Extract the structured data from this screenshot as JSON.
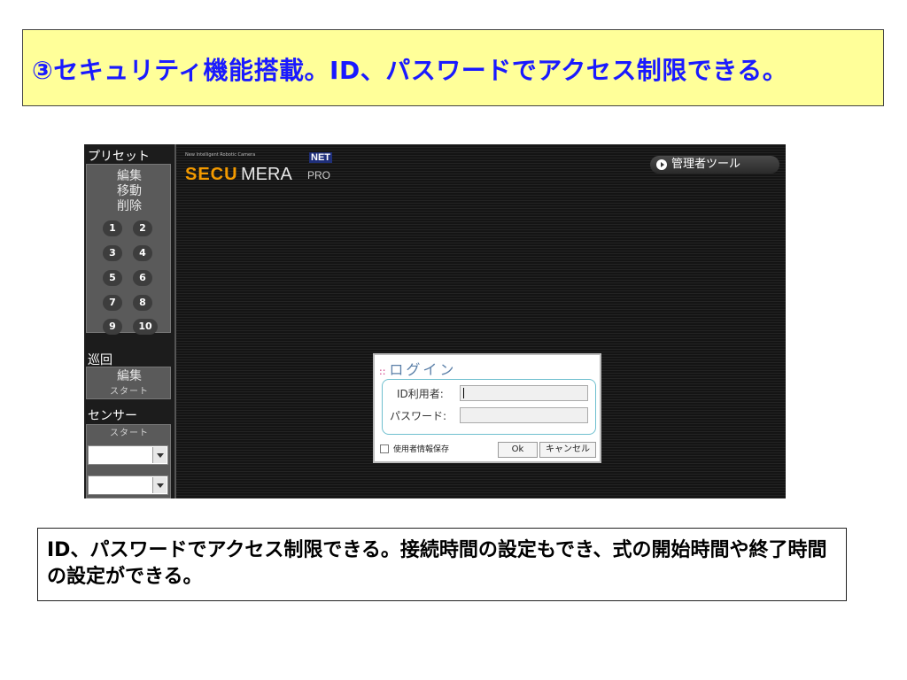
{
  "title": "③セキュリティ機能搭載。ID、パスワードでアクセス制限できる。",
  "sidebar": {
    "preset_title": "プリセット",
    "preset_items": [
      "編集",
      "移動",
      "削除"
    ],
    "preset_buttons": [
      "1",
      "2",
      "3",
      "4",
      "5",
      "6",
      "7",
      "8",
      "9",
      "10"
    ],
    "patrol_title": "巡回",
    "patrol_items": [
      "編集",
      "スタート"
    ],
    "sensor_title": "センサー",
    "sensor_items": [
      "スタート"
    ],
    "select1_value": "",
    "select2_value": ""
  },
  "logo": {
    "tagline": "New Intelligent Robotic Camera",
    "secu": "SECU",
    "mera": "MERA",
    "pro": "PRO",
    "net": "NET",
    "brand_color": "#f39a00"
  },
  "admin_tool": {
    "label": "管理者ツール",
    "icon": "arrow-right-circle-icon"
  },
  "login": {
    "title": "ログイン",
    "title_icon": "::",
    "id_label": "ID利用者:",
    "id_value": "",
    "password_label": "パスワード:",
    "password_value": "",
    "remember_label": "使用者情報保存",
    "remember_checked": false,
    "ok_label": "Ok",
    "cancel_label": "キャンセル"
  },
  "description": "ID、パスワードでアクセス制限できる。接続時間の設定もでき、式の開始時間や終了時間の設定ができる。",
  "colors": {
    "title_bg": "#ffff99",
    "title_text": "#1a1aff",
    "accent": "#6fbfcf"
  }
}
